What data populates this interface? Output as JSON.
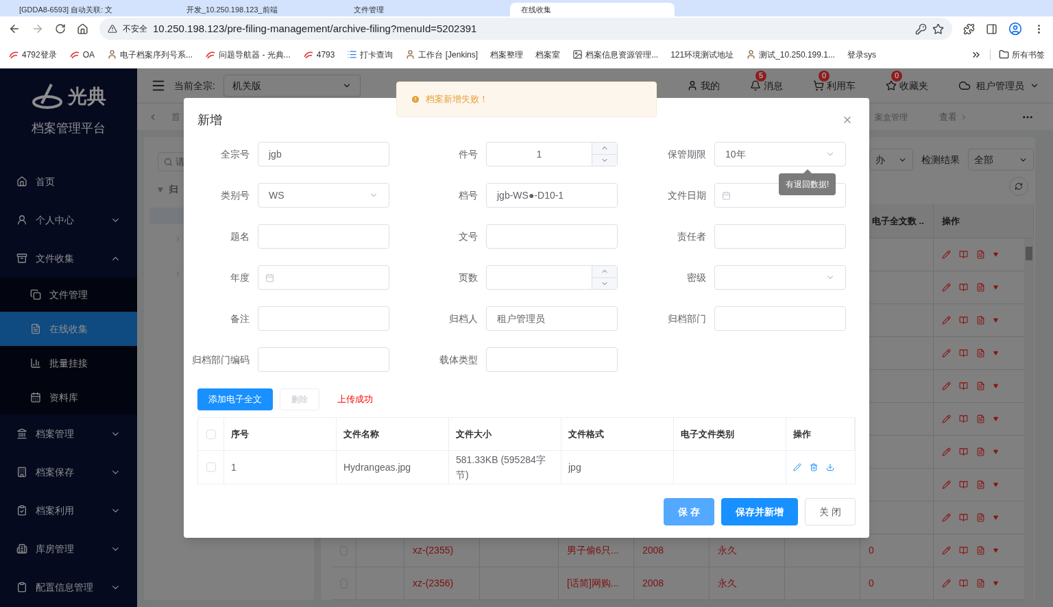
{
  "browser": {
    "tabs": [
      {
        "title": "[GDDA8-6593] 自动关联: 文",
        "selected": false
      },
      {
        "title": "开发_10.250.198.123_前端",
        "selected": false
      },
      {
        "title": "文件管理",
        "selected": false
      },
      {
        "title": "在线收集",
        "selected": true
      }
    ],
    "security": "不安全",
    "url": "10.250.198.123/pre-filing-management/archive-filing?menuId=5202391",
    "bookmarks": [
      {
        "label": "4792登录",
        "kind": "logo"
      },
      {
        "label": "OA",
        "kind": "logo"
      },
      {
        "label": "电子档案序列号系...",
        "kind": "person"
      },
      {
        "label": "问题导航器 - 光典...",
        "kind": "logo"
      },
      {
        "label": "4793",
        "kind": "logo"
      },
      {
        "label": "打卡查询",
        "kind": "list"
      },
      {
        "label": "工作台 [Jenkins]",
        "kind": "person"
      },
      {
        "label": "档案整理",
        "kind": "plain"
      },
      {
        "label": "档案室",
        "kind": "plain"
      },
      {
        "label": "档案信息资源管理...",
        "kind": "image"
      },
      {
        "label": "121环境测试地址",
        "kind": "plain"
      },
      {
        "label": "测试_10.250.199.1...",
        "kind": "person"
      },
      {
        "label": "登录sys",
        "kind": "plain"
      }
    ],
    "all_bookmarks": "所有书签"
  },
  "sidebar": {
    "logo": "光典",
    "title": "档案管理平台",
    "items": [
      {
        "label": "首页",
        "expandable": false
      },
      {
        "label": "个人中心",
        "expandable": true,
        "expanded": false
      },
      {
        "label": "文件收集",
        "expandable": true,
        "expanded": true,
        "children": [
          {
            "label": "文件管理",
            "selected": false
          },
          {
            "label": "在线收集",
            "selected": true
          },
          {
            "label": "批量挂接",
            "selected": false
          },
          {
            "label": "资料库",
            "selected": false
          }
        ]
      },
      {
        "label": "档案管理",
        "expandable": true,
        "expanded": false
      },
      {
        "label": "档案保存",
        "expandable": true,
        "expanded": false
      },
      {
        "label": "档案利用",
        "expandable": true,
        "expanded": false
      },
      {
        "label": "库房管理",
        "expandable": true,
        "expanded": false
      },
      {
        "label": "配置信息管理",
        "expandable": true,
        "expanded": false
      }
    ]
  },
  "header": {
    "fonds_label": "当前全宗:",
    "fonds_value": "机关版",
    "nav": [
      {
        "label": "我的"
      },
      {
        "label": "消息",
        "badge": "5"
      },
      {
        "label": "利用车",
        "badge": "0"
      },
      {
        "label": "收藏夹",
        "badge": "0"
      }
    ],
    "user": "租户管理员"
  },
  "page_tabs": [
    "首",
    "案盒管理",
    "查看"
  ],
  "tree": {
    "search_placeholder": "请",
    "root": "归"
  },
  "filters": {
    "select_1": "办",
    "result_label": "检测结果",
    "result_value": "全部"
  },
  "table": {
    "columns": [
      "电子全文数 ..",
      "操作"
    ],
    "rows": [
      {
        "kind": "covered"
      },
      {
        "kind": "covered"
      },
      {
        "kind": "covered"
      },
      {
        "kind": "covered"
      },
      {
        "kind": "covered"
      },
      {
        "kind": "covered"
      },
      {
        "kind": "covered"
      },
      {
        "kind": "covered"
      },
      {
        "kind": "covered"
      },
      {
        "kind": "full",
        "checked": false,
        "code": "xz-(2355)",
        "title": "男子偷6只...",
        "year": "2008",
        "term": "永久",
        "count": "0"
      },
      {
        "kind": "full",
        "checked": false,
        "code": "xz-(2356)",
        "title": "[话简]网购...",
        "year": "2008",
        "term": "永久",
        "count": "0"
      }
    ]
  },
  "dialog": {
    "title": "新增",
    "toast": "档案新增失败！",
    "fields": [
      {
        "label": "全宗号",
        "kind": "input",
        "value": "jgb"
      },
      {
        "label": "件号",
        "kind": "number",
        "value": "1"
      },
      {
        "label": "保管期限",
        "kind": "select",
        "value": "10年",
        "tooltip": "有退回数据!"
      },
      {
        "label": "类别号",
        "kind": "select",
        "value": "WS"
      },
      {
        "label": "档号",
        "kind": "input",
        "value": "jgb-WS●-D10-1"
      },
      {
        "label": "文件日期",
        "kind": "date"
      },
      {
        "label": "题名",
        "kind": "input"
      },
      {
        "label": "文号",
        "kind": "input"
      },
      {
        "label": "责任者",
        "kind": "input"
      },
      {
        "label": "年度",
        "kind": "date"
      },
      {
        "label": "页数",
        "kind": "number"
      },
      {
        "label": "密级",
        "kind": "select"
      },
      {
        "label": "备注",
        "kind": "input"
      },
      {
        "label": "归档人",
        "kind": "input",
        "value": "租户管理员"
      },
      {
        "label": "归档部门",
        "kind": "input"
      },
      {
        "label": "归档部门编码",
        "kind": "input"
      },
      {
        "label": "载体类型",
        "kind": "input"
      }
    ],
    "add_button": "添加电子全文",
    "delete_button": {
      "label": "删除",
      "disabled": true
    },
    "upload_status": "上传成功",
    "files": {
      "all_checked": false,
      "columns": [
        "序号",
        "文件名称",
        "文件大小",
        "文件格式",
        "电子文件类别",
        "操作"
      ],
      "rows": [
        {
          "checked": false,
          "index": "1",
          "name": "Hydrangeas.jpg",
          "size": "581.33KB (595284字节)",
          "format": "jpg"
        }
      ]
    },
    "buttons": [
      {
        "label": "保 存",
        "kind": "light"
      },
      {
        "label": "保存并新增",
        "kind": "primary"
      },
      {
        "label": "关 闭",
        "kind": "plain"
      }
    ]
  }
}
